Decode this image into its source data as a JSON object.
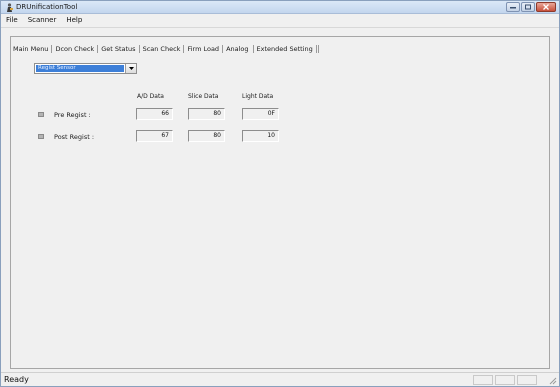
{
  "window": {
    "title": "DRUnificationTool"
  },
  "menu": [
    "File",
    "Scanner",
    "Help"
  ],
  "tabs": [
    "Main Menu",
    "Dcon Check",
    "Get Status",
    "Scan Check",
    "Firm Load",
    "Analog",
    "Extended Setting"
  ],
  "active_tab": "Analog",
  "sensor_select": {
    "value": "Regist Sensor"
  },
  "columns": [
    "A/D Data",
    "Slice Data",
    "Light Data"
  ],
  "rows": [
    {
      "label": "Pre Regist :",
      "ad": "66",
      "slice": "80",
      "light": "0F"
    },
    {
      "label": "Post Regist :",
      "ad": "67",
      "slice": "80",
      "light": "10"
    }
  ],
  "status": {
    "text": "Ready"
  },
  "icons": {
    "app": "scanner-person-icon",
    "minimize": "minimize-icon",
    "maximize": "maximize-icon",
    "close": "close-icon",
    "dropdown": "chevron-down-icon",
    "grip": "resize-grip-icon"
  }
}
